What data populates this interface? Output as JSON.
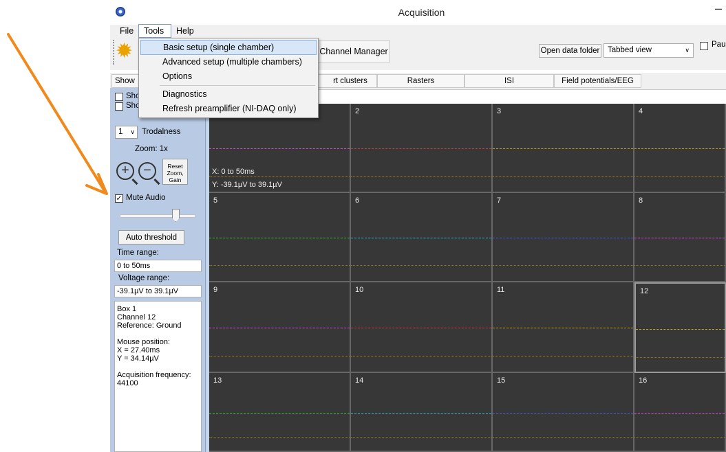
{
  "window": {
    "title": "Acquisition",
    "minimize_glyph": "–"
  },
  "menubar": {
    "items": [
      "File",
      "Tools",
      "Help"
    ]
  },
  "toolbar": {
    "channel_manager_label": "Channel Manager",
    "open_data_folder_label": "Open data folder",
    "view_select": {
      "selected": "Tabbed view"
    },
    "pause_label": "Paus"
  },
  "tabs": [
    "Show",
    "rt clusters",
    "Rasters",
    "ISI",
    "Field potentials/EEG"
  ],
  "tools_menu": {
    "items": [
      "Basic setup (single chamber)",
      "Advanced setup (multiple chambers)",
      "Options",
      "Diagnostics",
      "Refresh preamplifier (NI-DAQ only)"
    ],
    "highlighted": "Basic setup (single chamber)"
  },
  "left_panel": {
    "show_checkbox_1": "Sho",
    "show_checkbox_2": "Sho",
    "trodalness_value": "1",
    "trodalness_label": "Trodalness",
    "zoom_label": "Zoom: 1x",
    "reset_lines": [
      "Reset",
      "Zoom,",
      "Gain"
    ],
    "mute_audio_label": "Mute Audio",
    "mute_audio_checked": true,
    "auto_threshold_label": "Auto threshold",
    "time_range_label": "Time range:",
    "time_range_value": "0 to 50ms",
    "voltage_range_label": "Voltage range:",
    "voltage_range_value": "-39.1µV to 39.1µV",
    "info_lines": [
      "Box 1",
      "Channel 12",
      "Reference: Ground",
      "",
      "Mouse position:",
      "X = 27.40ms",
      "Y = 34.14µV",
      "",
      "Acquisition frequency:",
      "44100"
    ]
  },
  "grid": {
    "cells": [
      {
        "num": "",
        "color": "#d64fd6"
      },
      {
        "num": "2",
        "color": "#c94040"
      },
      {
        "num": "3",
        "color": "#c9a020"
      },
      {
        "num": "4",
        "color": "#c9a020"
      },
      {
        "num": "5",
        "color": "#3cbf3c"
      },
      {
        "num": "6",
        "color": "#3ab8c8"
      },
      {
        "num": "7",
        "color": "#4a5fe0"
      },
      {
        "num": "8",
        "color": "#d64fd6"
      },
      {
        "num": "9",
        "color": "#d64fd6"
      },
      {
        "num": "10",
        "color": "#d04040"
      },
      {
        "num": "11",
        "color": "#c9a020"
      },
      {
        "num": "12",
        "color": "#c9a020"
      },
      {
        "num": "13",
        "color": "#3cbf3c"
      },
      {
        "num": "14",
        "color": "#3ab8c8"
      },
      {
        "num": "15",
        "color": "#4a5fe0"
      },
      {
        "num": "16",
        "color": "#d64fd6"
      }
    ],
    "selected_cell": "12",
    "x_label": "X: 0 to 50ms",
    "y_label": "Y: -39.1µV to 39.1µV"
  },
  "colors": {
    "panel_bg": "#b9cbe4",
    "grid_bg": "#373737",
    "arrow": "#f08a1c"
  }
}
